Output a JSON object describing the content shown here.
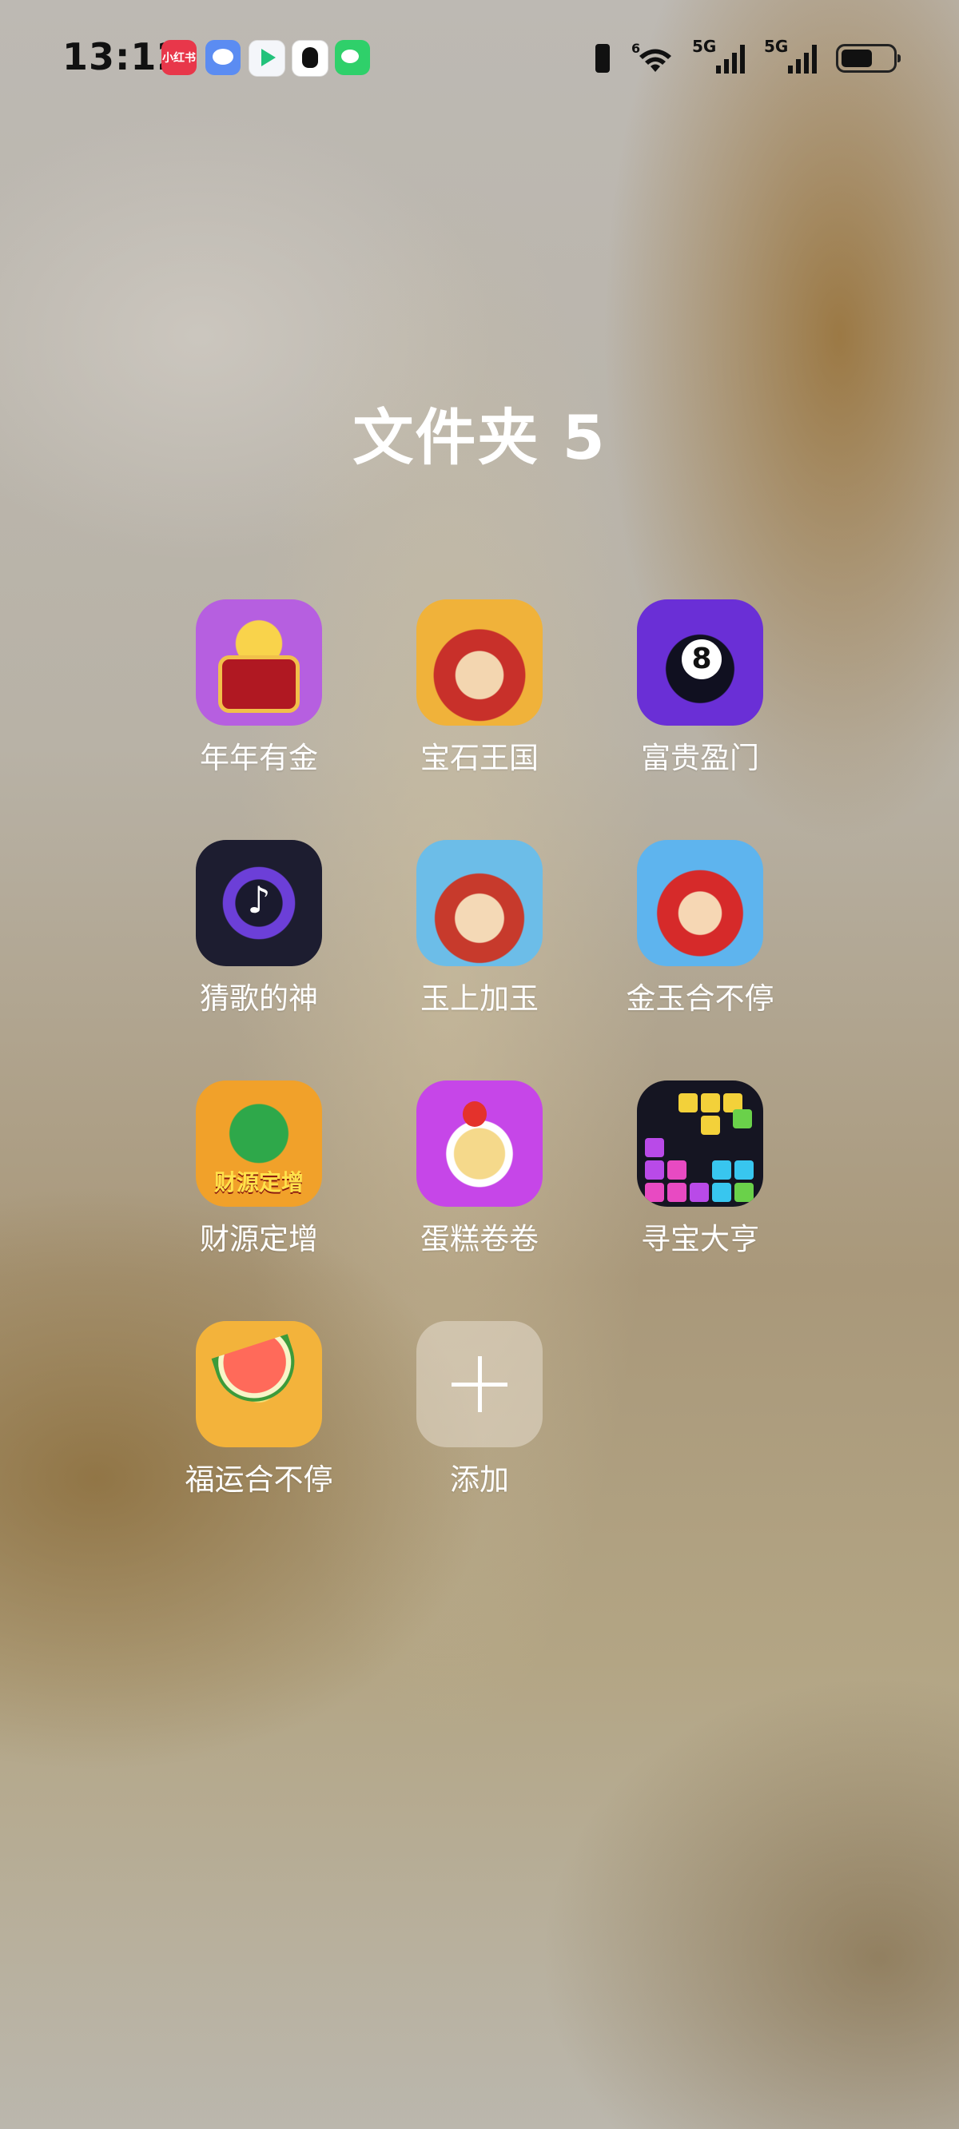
{
  "status_bar": {
    "time": "13:12",
    "notification_icons": [
      "xiaohongshu-icon",
      "messages-icon",
      "video-app-icon",
      "qq-icon",
      "wechat-icon"
    ],
    "xiaohongshu_text": "小红书",
    "network_1": "5G",
    "network_2": "5G",
    "wifi_tag": "6"
  },
  "folder": {
    "title": "文件夹 5",
    "apps": [
      {
        "label": "年年有金",
        "icon": "treasure-chest-icon"
      },
      {
        "label": "宝石王国",
        "icon": "fortune-god-icon"
      },
      {
        "label": "富贵盈门",
        "icon": "eight-ball-icon"
      },
      {
        "label": "猜歌的神",
        "icon": "music-disc-icon"
      },
      {
        "label": "玉上加玉",
        "icon": "fortune-god-icon"
      },
      {
        "label": "金玉合不停",
        "icon": "boy-character-icon"
      },
      {
        "label": "财源定增",
        "icon": "green-gem-icon"
      },
      {
        "label": "蛋糕卷卷",
        "icon": "cake-roll-icon"
      },
      {
        "label": "寻宝大亨",
        "icon": "block-puzzle-icon"
      },
      {
        "label": "福运合不停",
        "icon": "watermelon-icon"
      },
      {
        "label": "添加",
        "icon": "plus-icon"
      }
    ]
  }
}
